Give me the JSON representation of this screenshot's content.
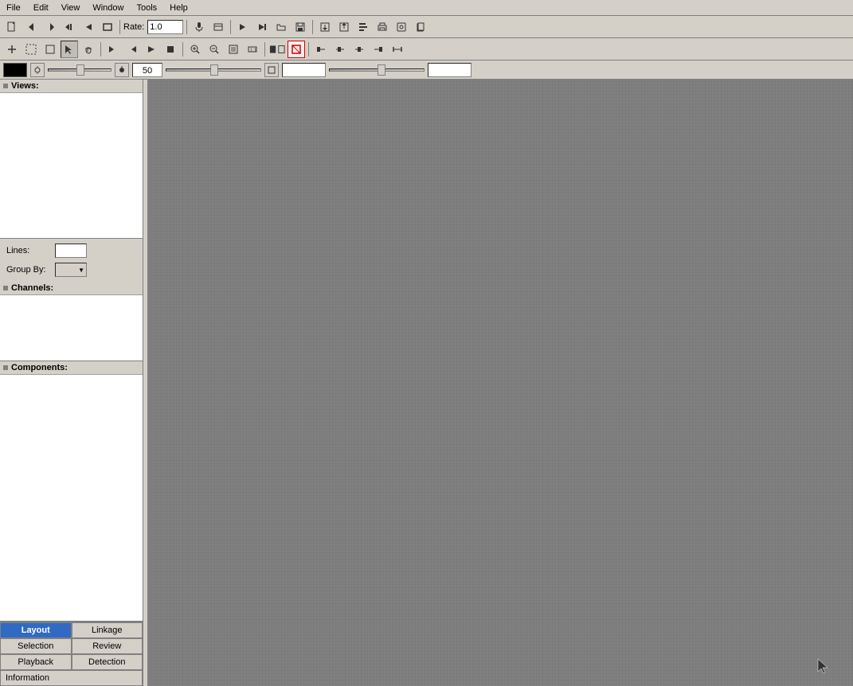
{
  "menubar": {
    "items": [
      "File",
      "Edit",
      "View",
      "Window",
      "Tools",
      "Help"
    ]
  },
  "toolbar1": {
    "rate_label": "Rate:",
    "rate_value": "1.0",
    "buttons": [
      "new",
      "select-rect",
      "select-free",
      "cursor",
      "hand",
      "separator",
      "play-back",
      "play-prev",
      "play",
      "play-next",
      "play-fwd",
      "separator",
      "rec",
      "open",
      "save",
      "separator",
      "mic",
      "mic-settings",
      "separator",
      "export",
      "import",
      "batch"
    ]
  },
  "toolbar2": {
    "buttons": [
      "add",
      "select-dots",
      "select-lasso",
      "cursor-tool",
      "hand-tool",
      "separator",
      "play-tool",
      "stop-tool",
      "mark-in",
      "mark-out",
      "separator",
      "zoom-in",
      "zoom-out",
      "zoom-fit",
      "zoom-full",
      "separator",
      "view1",
      "view2",
      "view3",
      "separator",
      "link1",
      "link2",
      "link3",
      "link4",
      "link5"
    ]
  },
  "slider_toolbar": {
    "color": "#000000",
    "brightness_label": "Brightness",
    "brightness_value": "50",
    "contrast_value": "",
    "extra_value": ""
  },
  "sidebar": {
    "views_label": "Views:",
    "lines_label": "Lines:",
    "lines_value": "",
    "group_by_label": "Group By:",
    "group_by_value": "",
    "channels_label": "Channels:",
    "components_label": "Components:"
  },
  "bottom_tabs": {
    "tabs": [
      {
        "label": "Layout",
        "active": true
      },
      {
        "label": "Linkage",
        "active": false
      },
      {
        "label": "Selection",
        "active": false
      },
      {
        "label": "Review",
        "active": false
      },
      {
        "label": "Playback",
        "active": false
      },
      {
        "label": "Detection",
        "active": false
      },
      {
        "label": "Information",
        "active": false
      }
    ]
  },
  "canvas": {
    "background_color": "#808080"
  }
}
